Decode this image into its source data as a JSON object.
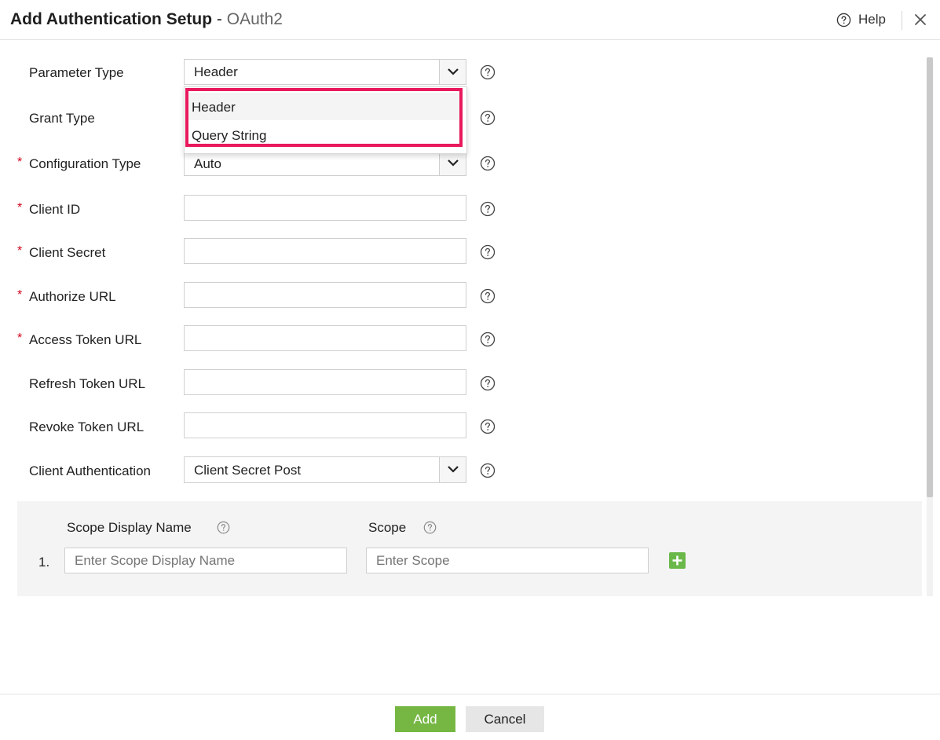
{
  "header": {
    "title": "Add Authentication Setup",
    "title_separator": "-",
    "subtitle": "OAuth2",
    "help_label": "Help",
    "help_icon": "question-circle-icon",
    "close_icon": "close-icon"
  },
  "form": {
    "parameter_type": {
      "label": "Parameter Type",
      "value": "Header"
    },
    "grant_type": {
      "label": "Grant Type"
    },
    "configuration_type": {
      "label": "Configuration Type",
      "required": "*",
      "value": "Auto"
    },
    "client_id": {
      "label": "Client ID",
      "required": "*",
      "value": ""
    },
    "client_secret": {
      "label": "Client Secret",
      "required": "*",
      "value": ""
    },
    "authorize_url": {
      "label": "Authorize URL",
      "required": "*",
      "value": ""
    },
    "access_token_url": {
      "label": "Access Token URL",
      "required": "*",
      "value": ""
    },
    "refresh_token_url": {
      "label": "Refresh Token URL",
      "value": ""
    },
    "revoke_token_url": {
      "label": "Revoke Token URL",
      "value": ""
    },
    "client_authentication": {
      "label": "Client Authentication",
      "value": "Client Secret Post"
    }
  },
  "dropdown": {
    "options": [
      "Header",
      "Query String"
    ],
    "highlight_color": "#e8195c"
  },
  "scope": {
    "display_name_header": "Scope Display Name",
    "scope_header": "Scope",
    "rows": [
      {
        "number": "1.",
        "display_name_placeholder": "Enter Scope Display Name",
        "scope_placeholder": "Enter Scope"
      }
    ],
    "add_icon": "plus-icon"
  },
  "footer": {
    "add_label": "Add",
    "cancel_label": "Cancel"
  },
  "colors": {
    "primary_green": "#76b744",
    "required_red": "#d0021b"
  }
}
